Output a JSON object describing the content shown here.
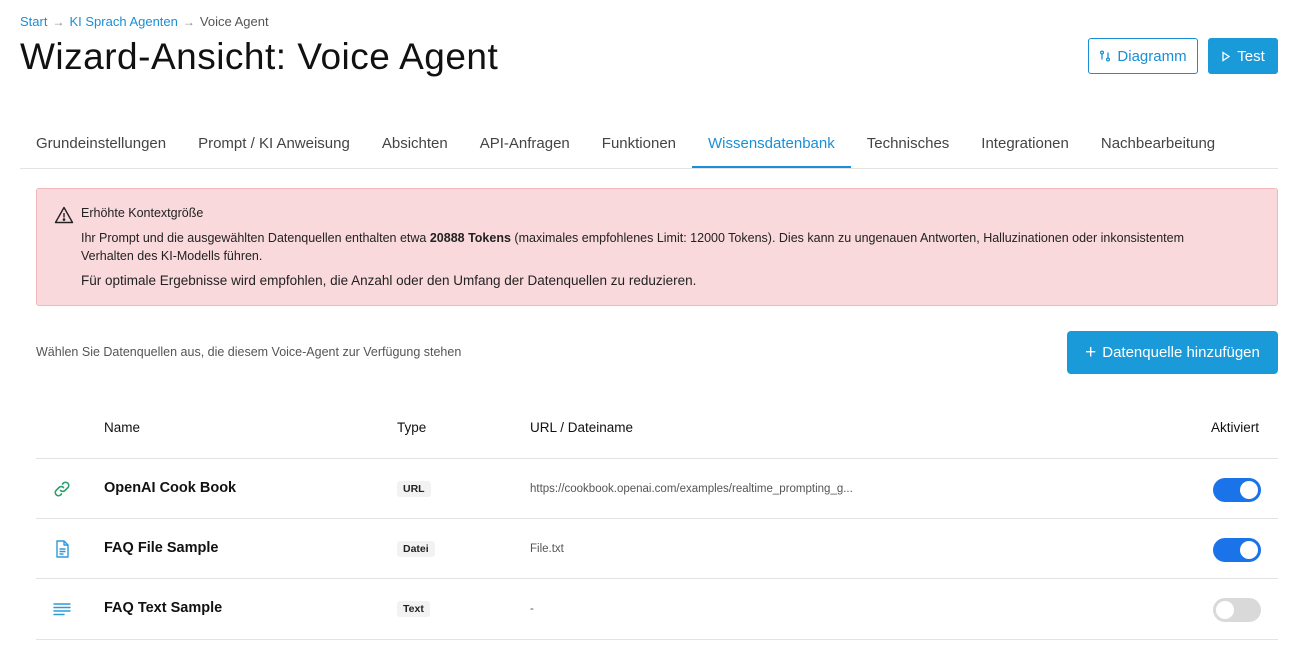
{
  "breadcrumb": {
    "items": [
      "Start",
      "KI Sprach Agenten",
      "Voice Agent"
    ],
    "separator": "→"
  },
  "header": {
    "title": "Wizard-Ansicht: Voice Agent",
    "diagram_label": "Diagramm",
    "test_label": "Test"
  },
  "tabs": [
    {
      "label": "Grundeinstellungen",
      "active": false
    },
    {
      "label": "Prompt / KI Anweisung",
      "active": false
    },
    {
      "label": "Absichten",
      "active": false
    },
    {
      "label": "API-Anfragen",
      "active": false
    },
    {
      "label": "Funktionen",
      "active": false
    },
    {
      "label": "Wissensdatenbank",
      "active": true
    },
    {
      "label": "Technisches",
      "active": false
    },
    {
      "label": "Integrationen",
      "active": false
    },
    {
      "label": "Nachbearbeitung",
      "active": false
    }
  ],
  "alert": {
    "title": "Erhöhte Kontextgröße",
    "line1_prefix": "Ihr Prompt und die ausgewählten Datenquellen enthalten etwa ",
    "line1_bold": "20888 Tokens",
    "line1_suffix": " (maximales empfohlenes Limit: 12000 Tokens). Dies kann zu ungenauen Antworten, Halluzinationen oder inkonsistentem Verhalten des KI-Modells führen.",
    "line2": "Für optimale Ergebnisse wird empfohlen, die Anzahl oder den Umfang der Datenquellen zu reduzieren."
  },
  "intro_text": "Wählen Sie Datenquellen aus, die diesem Voice-Agent zur Verfügung stehen",
  "add_button": {
    "plus": "+",
    "label": "Datenquelle hinzufügen"
  },
  "table": {
    "headers": {
      "name": "Name",
      "type": "Type",
      "url": "URL / Dateiname",
      "active": "Aktiviert"
    },
    "rows": [
      {
        "icon": "link-icon",
        "name": "OpenAI Cook Book",
        "type": "URL",
        "url": "https://cookbook.openai.com/examples/realtime_prompting_g...",
        "enabled": true
      },
      {
        "icon": "file-icon",
        "name": "FAQ File Sample",
        "type": "Datei",
        "url": "File.txt",
        "enabled": true
      },
      {
        "icon": "text-lines-icon",
        "name": "FAQ Text Sample",
        "type": "Text",
        "url": "-",
        "enabled": false
      }
    ]
  },
  "colors": {
    "accent": "#1a8fd6",
    "toggle_on": "#1a73e8",
    "alert_bg": "#f9d9dc",
    "alert_border": "#f2b6bc",
    "icon_green": "#2e9e6a"
  }
}
